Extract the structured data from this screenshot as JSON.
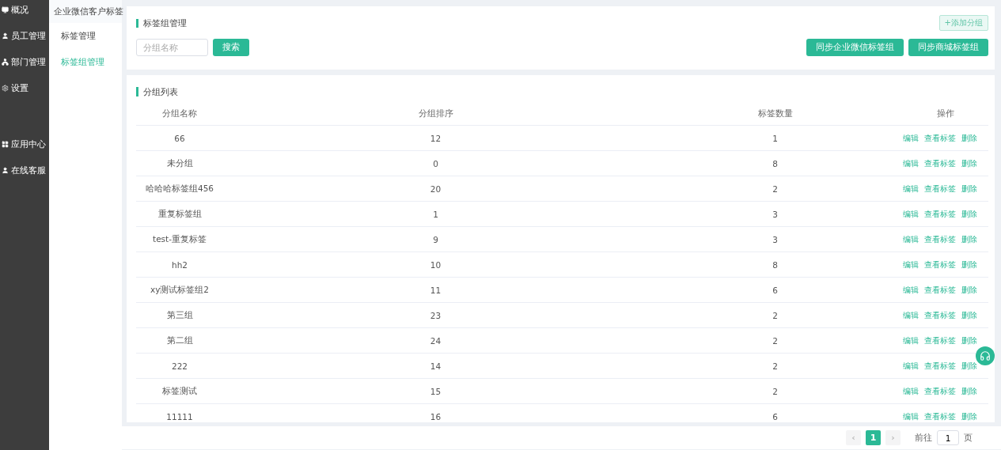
{
  "sidebar": {
    "groups": [
      {
        "items": [
          {
            "label": "概况",
            "kind": "monitor"
          },
          {
            "label": "员工管理",
            "kind": "user"
          },
          {
            "label": "部门管理",
            "kind": "org"
          },
          {
            "label": "设置",
            "kind": "gear"
          }
        ]
      },
      {
        "items": [
          {
            "label": "应用中心",
            "kind": "grid"
          },
          {
            "label": "在线客服",
            "kind": "user"
          }
        ]
      }
    ]
  },
  "subnav": {
    "heading": "企业微信客户标签",
    "items": [
      {
        "label": "标签管理",
        "selected": false
      },
      {
        "label": "标签组管理",
        "selected": true
      }
    ]
  },
  "filter_card": {
    "title": "标签组管理",
    "add_button": "+添加分组",
    "search_placeholder": "分组名称",
    "search_button": "搜索",
    "sync_buttons": [
      "同步企业微信标签组",
      "同步商城标签组"
    ]
  },
  "list_card": {
    "title": "分组列表",
    "columns": [
      "分组名称",
      "分组排序",
      "标签数量",
      "操作"
    ],
    "rows": [
      {
        "name": "66",
        "order": "12",
        "count": "1",
        "actions": [
          "编辑",
          "查看标签",
          "删除"
        ]
      },
      {
        "name": "未分组",
        "order": "0",
        "count": "8",
        "actions": [
          "编辑",
          "查看标签",
          "删除"
        ]
      },
      {
        "name": "哈哈哈标签组456",
        "order": "20",
        "count": "2",
        "actions": [
          "编辑",
          "查看标签",
          "删除"
        ]
      },
      {
        "name": "重复标签组",
        "order": "1",
        "count": "3",
        "actions": [
          "编辑",
          "查看标签",
          "删除"
        ]
      },
      {
        "name": "test-重复标签",
        "order": "9",
        "count": "3",
        "actions": [
          "编辑",
          "查看标签",
          "删除"
        ]
      },
      {
        "name": "hh2",
        "order": "10",
        "count": "8",
        "actions": [
          "编辑",
          "查看标签",
          "删除"
        ]
      },
      {
        "name": "xy测试标签组2",
        "order": "11",
        "count": "6",
        "actions": [
          "编辑",
          "查看标签",
          "删除"
        ]
      },
      {
        "name": "第三组",
        "order": "23",
        "count": "2",
        "actions": [
          "编辑",
          "查看标签",
          "删除"
        ]
      },
      {
        "name": "第二组",
        "order": "24",
        "count": "2",
        "actions": [
          "编辑",
          "查看标签",
          "删除"
        ]
      },
      {
        "name": "222",
        "order": "14",
        "count": "2",
        "actions": [
          "编辑",
          "查看标签",
          "删除"
        ]
      },
      {
        "name": "标签测试",
        "order": "15",
        "count": "2",
        "actions": [
          "编辑",
          "查看标签",
          "删除"
        ]
      },
      {
        "name": "11111",
        "order": "16",
        "count": "6",
        "actions": [
          "编辑",
          "查看标签",
          "删除"
        ]
      }
    ]
  },
  "pagination": {
    "prev": "‹",
    "pages": [
      {
        "label": "1",
        "selected": true
      }
    ],
    "next": "›",
    "goto_label": "前往",
    "goto_value": "1",
    "page_unit": "页"
  }
}
